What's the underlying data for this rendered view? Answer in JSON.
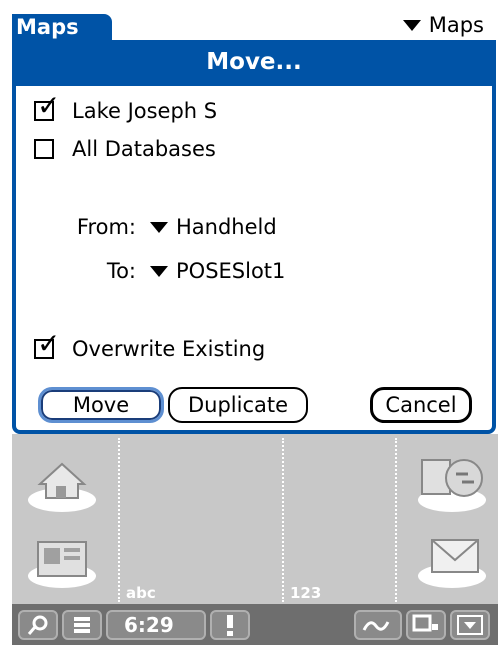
{
  "app": {
    "tab_label": "Maps",
    "menu_label": "Maps"
  },
  "dialog": {
    "title": "Move...",
    "items": [
      {
        "label": "Lake Joseph S",
        "checked": true
      },
      {
        "label": "All Databases",
        "checked": false
      }
    ],
    "from": {
      "label": "From:",
      "value": "Handheld"
    },
    "to": {
      "label": "To:",
      "value": "POSESlot1"
    },
    "overwrite": {
      "label": "Overwrite Existing",
      "checked": true
    },
    "buttons": {
      "move": "Move",
      "duplicate": "Duplicate",
      "cancel": "Cancel"
    }
  },
  "silkscreen": {
    "left_label": "abc",
    "right_label": "123"
  },
  "status": {
    "clock": "6:29"
  },
  "colors": {
    "accent": "#0053a6",
    "silkscreen": "#c8c8c8",
    "statusbar": "#6e6e6e"
  }
}
